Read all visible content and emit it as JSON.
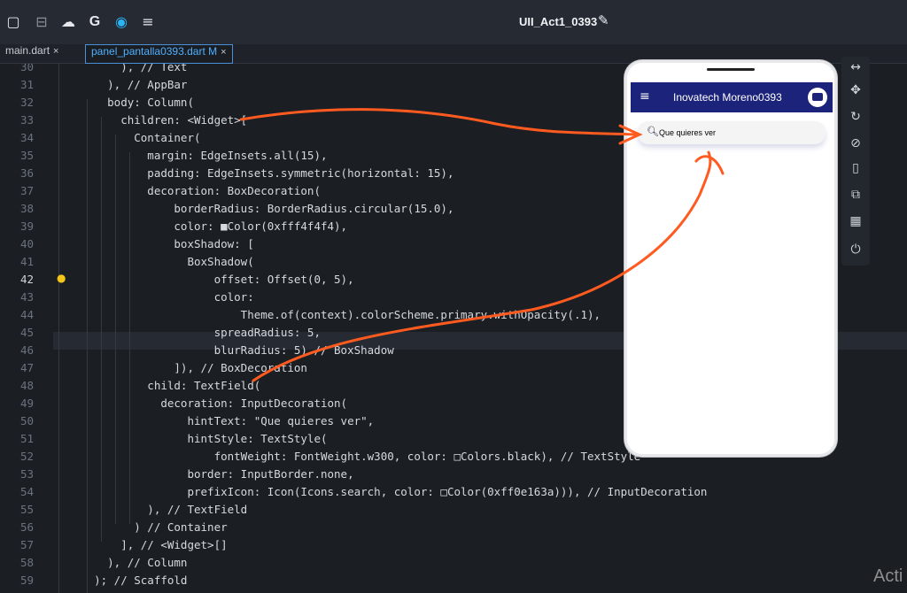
{
  "toolbar": {
    "icons": [
      "square-icon",
      "save-icon",
      "cloud-icon",
      "g-icon",
      "record-icon",
      "menu-icon"
    ],
    "title": "UII_Act1_0393"
  },
  "tabs": [
    {
      "label": "main.dart",
      "close": "×"
    },
    {
      "label": "panel_pantalla0393.dart M",
      "close": "×"
    }
  ],
  "code_lines": [
    {
      "n": "30",
      "text": "        ), // Text"
    },
    {
      "n": "31",
      "text": "      ), // AppBar"
    },
    {
      "n": "32",
      "text": "      body: Column("
    },
    {
      "n": "33",
      "text": "        children: <Widget>["
    },
    {
      "n": "34",
      "text": "          Container("
    },
    {
      "n": "35",
      "text": "            margin: EdgeInsets.all(15),"
    },
    {
      "n": "36",
      "text": "            padding: EdgeInsets.symmetric(horizontal: 15),"
    },
    {
      "n": "37",
      "text": "            decoration: BoxDecoration("
    },
    {
      "n": "38",
      "text": "                borderRadius: BorderRadius.circular(15.0),"
    },
    {
      "n": "39",
      "text": "                color: ■Color(0xfff4f4f4),"
    },
    {
      "n": "40",
      "text": "                boxShadow: ["
    },
    {
      "n": "41",
      "text": "                  BoxShadow("
    },
    {
      "n": "42",
      "text": "                      offset: Offset(0, 5),"
    },
    {
      "n": "43",
      "text": "                      color:"
    },
    {
      "n": "44",
      "text": "                          Theme.of(context).colorScheme.primary.withOpacity(.1),"
    },
    {
      "n": "45",
      "text": "                      spreadRadius: 5,"
    },
    {
      "n": "46",
      "text": "                      blurRadius: 5) // BoxShadow"
    },
    {
      "n": "47",
      "text": "                ]), // BoxDecoration"
    },
    {
      "n": "48",
      "text": "            child: TextField("
    },
    {
      "n": "49",
      "text": "              decoration: InputDecoration("
    },
    {
      "n": "50",
      "text": "                  hintText: \"Que quieres ver\","
    },
    {
      "n": "51",
      "text": "                  hintStyle: TextStyle("
    },
    {
      "n": "52",
      "text": "                      fontWeight: FontWeight.w300, color: □Colors.black), // TextStyle"
    },
    {
      "n": "53",
      "text": "                  border: InputBorder.none,"
    },
    {
      "n": "54",
      "text": "                  prefixIcon: Icon(Icons.search, color: □Color(0xff0e163a))), // InputDecoration"
    },
    {
      "n": "55",
      "text": "            ), // TextField"
    },
    {
      "n": "56",
      "text": "          ) // Container"
    },
    {
      "n": "57",
      "text": "        ], // <Widget>[]"
    },
    {
      "n": "58",
      "text": "      ), // Column"
    },
    {
      "n": "59",
      "text": "    ); // Scaffold"
    }
  ],
  "current_line": "42",
  "phone": {
    "app_title": "Inovatech Moreno0393",
    "search_hint": "Que quieres ver",
    "appbar_color": "#1c237a",
    "search_icon_color": "#0e163a"
  },
  "emulator_tools": [
    "resize-icon",
    "move-icon",
    "rotate-icon",
    "rotate-device-icon",
    "device-icon",
    "external-link-icon",
    "qr-code-icon",
    "power-icon"
  ],
  "watermark": "Acti",
  "annotation_color": "#ff5a1f"
}
